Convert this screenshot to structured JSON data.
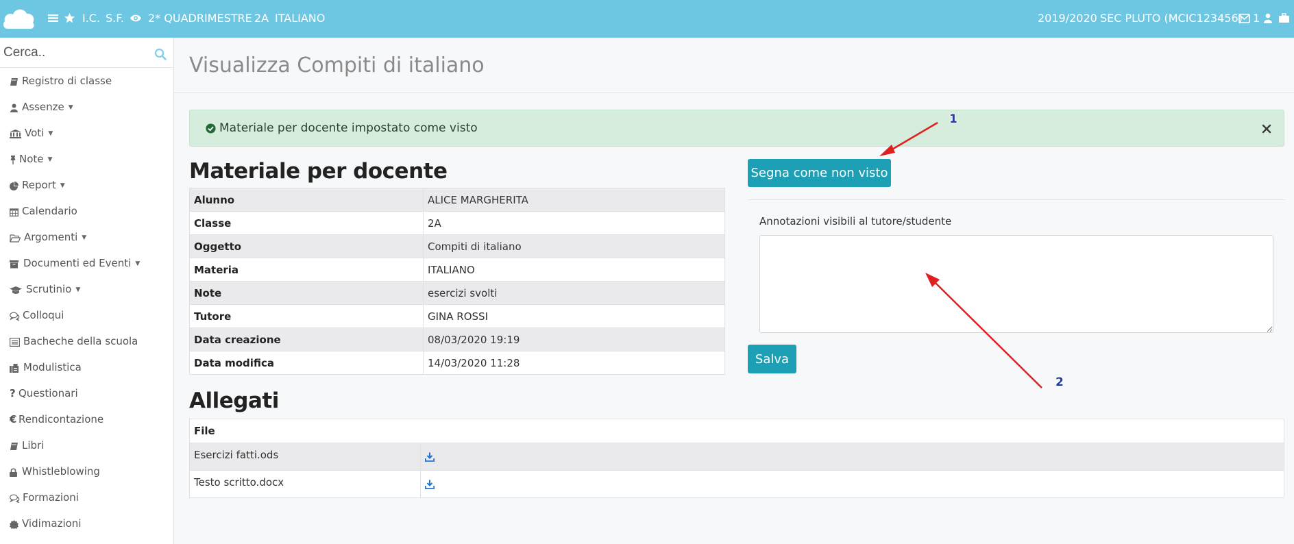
{
  "topbar": {
    "breadcrumb": [
      "I.C.",
      "S.F.",
      "2* QUADRIMESTRE",
      "2A",
      "ITALIANO"
    ],
    "year": "2019/2020",
    "school": "SEC PLUTO (MCIC123456)",
    "messages_count": "1",
    "icons": [
      "cloud-logo",
      "menu-icon",
      "star-icon",
      "eye-icon",
      "envelope-icon",
      "user-icon",
      "briefcase-icon"
    ]
  },
  "sidebar": {
    "search_placeholder": "Cerca..",
    "items": [
      {
        "label": "Registro di classe",
        "icon": "book-icon",
        "has_submenu": false
      },
      {
        "label": "Assenze",
        "icon": "user-icon",
        "has_submenu": true
      },
      {
        "label": "Voti",
        "icon": "institution-icon",
        "has_submenu": true
      },
      {
        "label": "Note",
        "icon": "pin-icon",
        "has_submenu": true
      },
      {
        "label": "Report",
        "icon": "pie-chart-icon",
        "has_submenu": true
      },
      {
        "label": "Calendario",
        "icon": "calendar-icon",
        "has_submenu": false
      },
      {
        "label": "Argomenti",
        "icon": "folder-open-icon",
        "has_submenu": true
      },
      {
        "label": "Documenti ed Eventi",
        "icon": "archive-icon",
        "has_submenu": true
      },
      {
        "label": "Scrutinio",
        "icon": "graduation-cap-icon",
        "has_submenu": true
      },
      {
        "label": "Colloqui",
        "icon": "comments-icon",
        "has_submenu": false
      },
      {
        "label": "Bacheche della scuola",
        "icon": "list-alt-icon",
        "has_submenu": false
      },
      {
        "label": "Modulistica",
        "icon": "fax-icon",
        "has_submenu": false
      },
      {
        "label": "Questionari",
        "icon": "question-icon",
        "has_submenu": false
      },
      {
        "label": "Rendicontazione",
        "icon": "euro-icon",
        "has_submenu": false
      },
      {
        "label": "Libri",
        "icon": "book-icon",
        "has_submenu": false
      },
      {
        "label": "Whistleblowing",
        "icon": "lock-icon",
        "has_submenu": false
      },
      {
        "label": "Formazioni",
        "icon": "comments-icon",
        "has_submenu": false
      },
      {
        "label": "Vidimazioni",
        "icon": "certificate-icon",
        "has_submenu": false
      }
    ]
  },
  "page": {
    "title": "Visualizza Compiti di italiano"
  },
  "alert": {
    "message": "Materiale per docente impostato come visto",
    "color": "#d6ecdd"
  },
  "detail": {
    "heading": "Materiale per docente",
    "rows": [
      {
        "key": "Alunno",
        "value": "ALICE MARGHERITA"
      },
      {
        "key": "Classe",
        "value": "2A"
      },
      {
        "key": "Oggetto",
        "value": "Compiti di italiano"
      },
      {
        "key": "Materia",
        "value": "ITALIANO"
      },
      {
        "key": "Note",
        "value": "esercizi svolti"
      },
      {
        "key": "Tutore",
        "value": "GINA ROSSI"
      },
      {
        "key": "Data creazione",
        "value": "08/03/2020 19:19"
      },
      {
        "key": "Data modifica",
        "value": "14/03/2020 11:28"
      }
    ]
  },
  "actions": {
    "mark_unseen_label": "Segna come non visto",
    "notes_label": "Annotazioni visibili al tutore/studente",
    "notes_value": "",
    "save_label": "Salva",
    "button_color": "#1da0b6"
  },
  "attachments": {
    "heading": "Allegati",
    "column_header": "File",
    "files": [
      {
        "name": "Esercizi fatti.ods",
        "icon": "download-icon"
      },
      {
        "name": "Testo scritto.docx",
        "icon": "download-icon"
      }
    ]
  },
  "annotations": {
    "callouts": [
      "1",
      "2"
    ],
    "arrow_color": "#e02020"
  },
  "colors": {
    "topbar": "#6dc6e2",
    "accent": "#1da0b6",
    "search_icon": "#7fd0e8"
  }
}
